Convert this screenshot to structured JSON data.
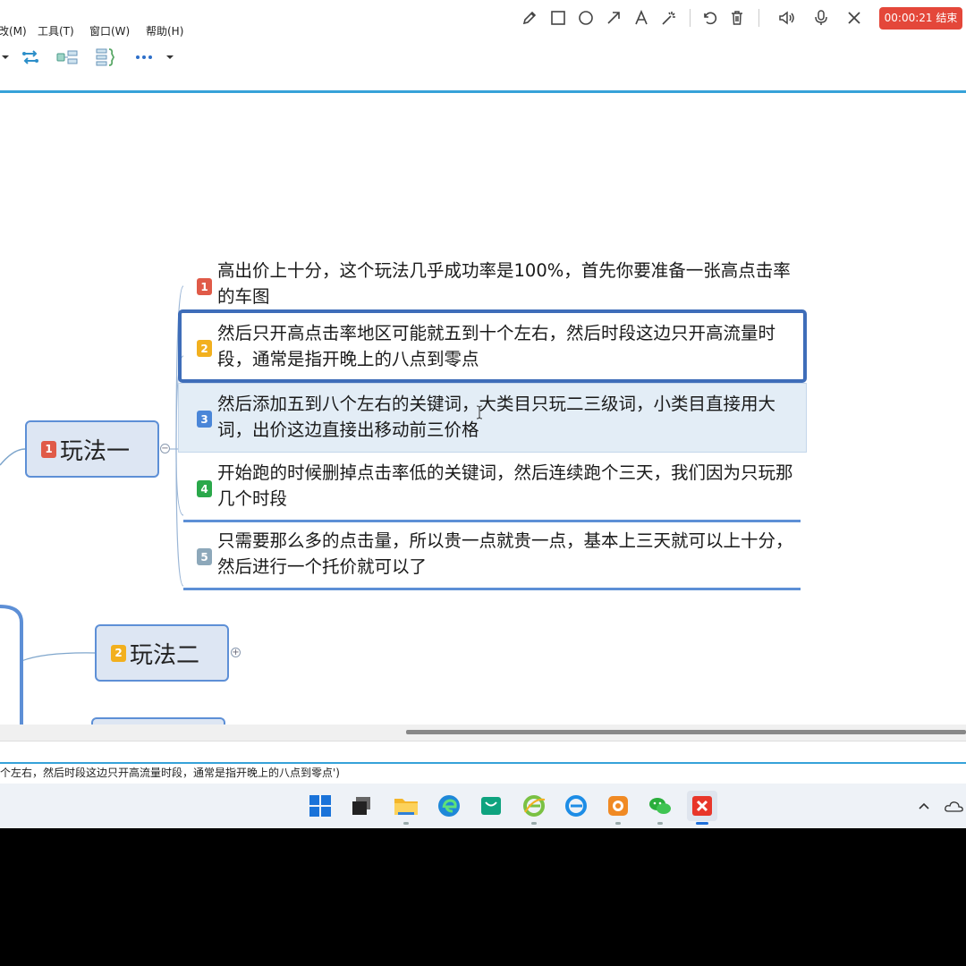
{
  "menu": [
    "改(M)",
    "工具(T)",
    "窗口(W)",
    "帮助(H)"
  ],
  "toolbar_icons": [
    "dropdown-arrow-icon",
    "swap-arrows-icon",
    "relationship-icon",
    "summary-icon",
    "more-icon",
    "more-dropdown-icon"
  ],
  "recorder": {
    "tools": [
      "pencil-icon",
      "rectangle-icon",
      "circle-icon",
      "arrow-icon",
      "text-icon",
      "magic-wand-icon",
      "undo-icon",
      "trash-icon",
      "speaker-icon",
      "microphone-icon",
      "close-icon"
    ],
    "timer": "00:00:21 结束",
    "timer_color": "#e4473a"
  },
  "mindmap": {
    "topic1": {
      "num": "1",
      "label": "玩法一",
      "badge_color": "#e05a48"
    },
    "topic2": {
      "num": "2",
      "label": "玩法二",
      "badge_color": "#f2b01e"
    },
    "subtopics": [
      {
        "num": "1",
        "text": "高出价上十分，这个玩法几乎成功率是100%，首先你要准备一张高点击率的车图",
        "color": "#e05a48"
      },
      {
        "num": "2",
        "text": "然后只开高点击率地区可能就五到十个左右，然后时段这边只开高流量时段，通常是指开晚上的八点到零点",
        "color": "#f2b01e"
      },
      {
        "num": "3",
        "text": "然后添加五到八个左右的关键词，大类目只玩二三级词，小类目直接用大词，出价这边直接出移动前三价格",
        "color": "#4a86d8"
      },
      {
        "num": "4",
        "text": "开始跑的时候删掉点击率低的关键词，然后连续跑个三天，我们因为只玩那几个时段",
        "color": "#2aa84a"
      },
      {
        "num": "5",
        "text": "只需要那么多的点击量，所以贵一点就贵一点，基本上三天就可以上十分，然后进行一个托价就可以了",
        "color": "#8da8ba"
      }
    ],
    "accent_color": "#5d8fd6"
  },
  "status_bar": "个左右，然后时段这边只开高流量时段，通常是指开晚上的八点到零点')",
  "taskbar": [
    "start-icon",
    "task-view-icon",
    "file-explorer-icon",
    "edge-icon",
    "store-icon",
    "ie-icon",
    "ie-blue-icon",
    "app-orange-icon",
    "wechat-icon",
    "xmind-icon"
  ],
  "tray": [
    "chevron-up-icon",
    "onedrive-icon"
  ]
}
